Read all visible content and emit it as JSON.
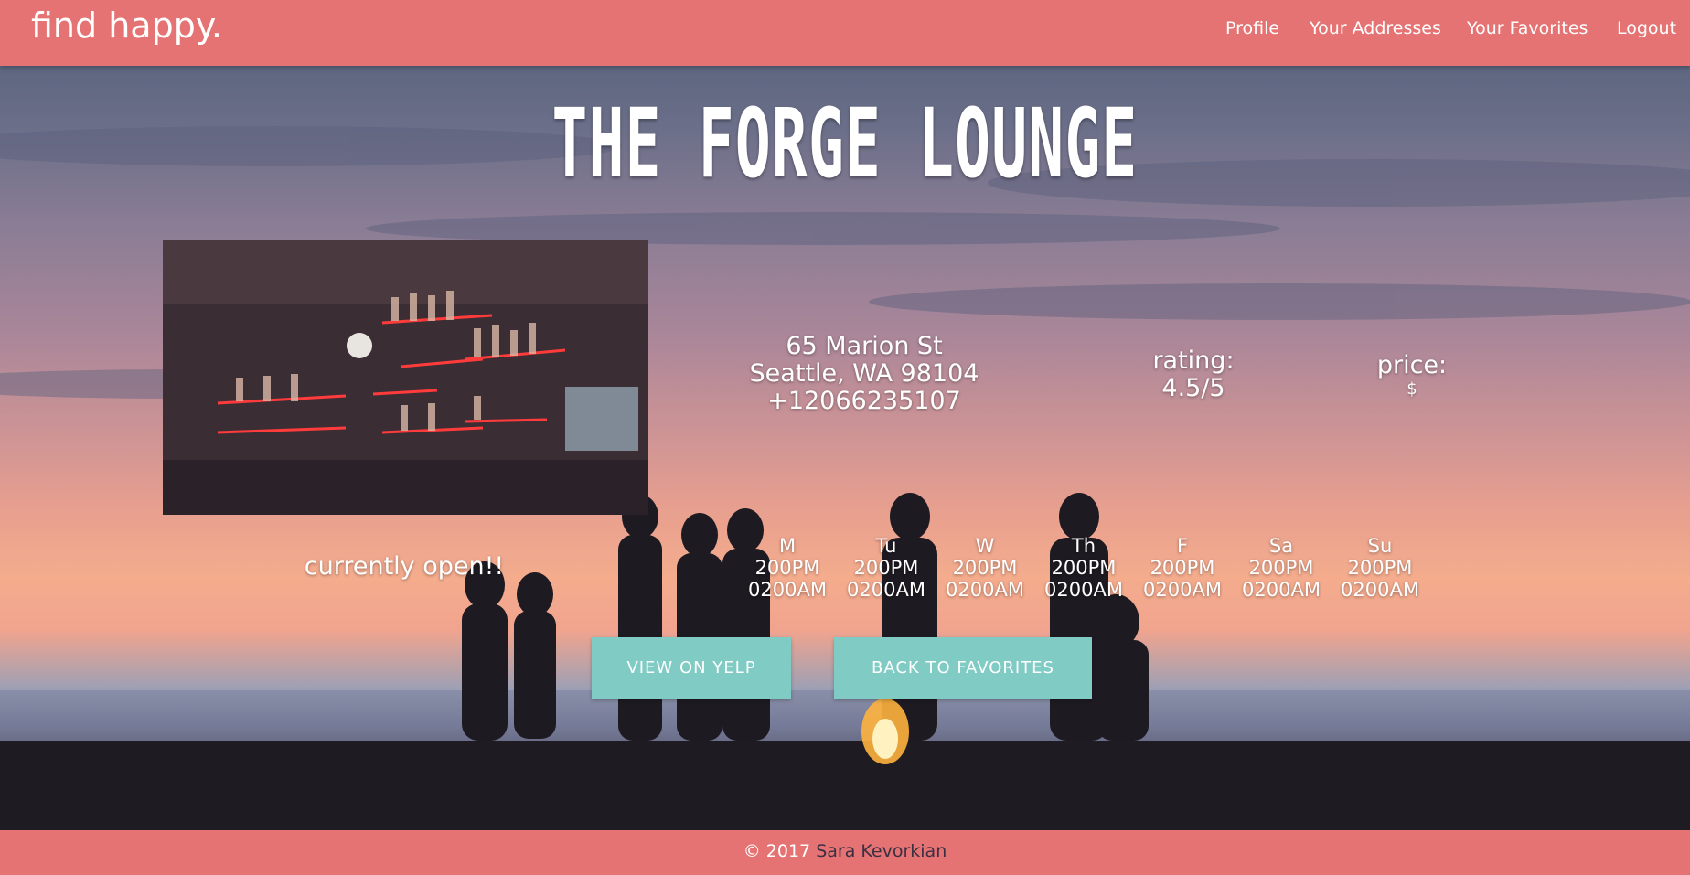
{
  "nav": {
    "brand": "find happy.",
    "links": [
      "Profile",
      "Your Addresses",
      "Your Favorites",
      "Logout"
    ]
  },
  "venue": {
    "name": "THE FORGE LOUNGE",
    "address_line1": "65 Marion St",
    "address_line2": "Seattle, WA 98104",
    "phone": "+12066235107",
    "rating_label": "rating:",
    "rating_value": "4.5/5",
    "price_label": "price:",
    "price_value": "$",
    "status": "currently open!!",
    "hours": [
      {
        "day": "M",
        "open": "200PM",
        "close": "0200AM"
      },
      {
        "day": "Tu",
        "open": "200PM",
        "close": "0200AM"
      },
      {
        "day": "W",
        "open": "200PM",
        "close": "0200AM"
      },
      {
        "day": "Th",
        "open": "200PM",
        "close": "0200AM"
      },
      {
        "day": "F",
        "open": "200PM",
        "close": "0200AM"
      },
      {
        "day": "Sa",
        "open": "200PM",
        "close": "0200AM"
      },
      {
        "day": "Su",
        "open": "200PM",
        "close": "0200AM"
      }
    ]
  },
  "buttons": {
    "yelp": "VIEW ON YELP",
    "back": "BACK TO FAVORITES"
  },
  "footer": {
    "copyright": "© 2017",
    "author": "Sara Kevorkian"
  },
  "colors": {
    "nav_bg": "#e57373",
    "button_bg": "#80cbc4",
    "text": "#ffffff"
  }
}
